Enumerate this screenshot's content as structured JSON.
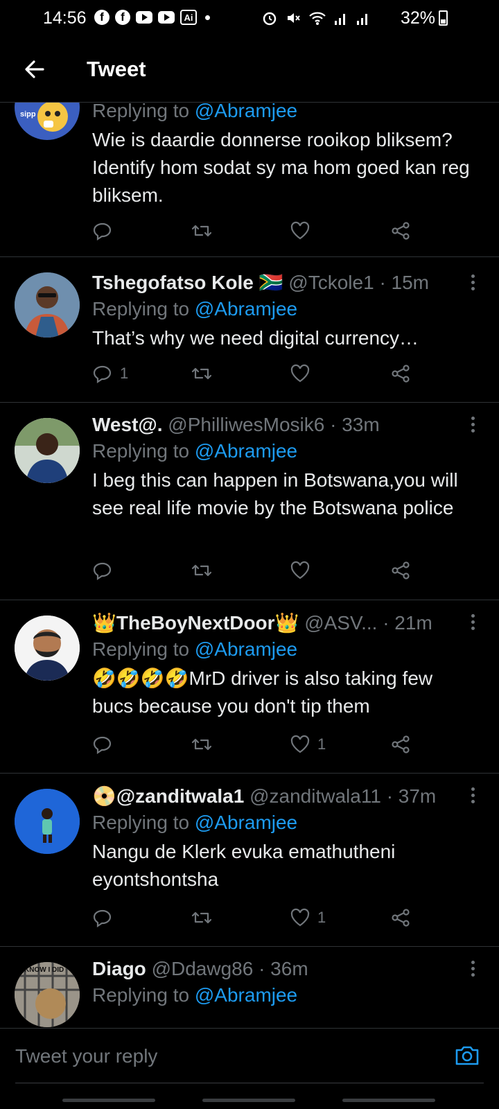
{
  "status_bar": {
    "time": "14:56",
    "battery": "32%",
    "app_icons": [
      "facebook-icon",
      "facebook-icon",
      "youtube-icon",
      "youtube-icon",
      "ai-icon",
      "dot"
    ],
    "system_icons": [
      "alarm-icon",
      "mute-icon",
      "wifi-icon",
      "signal-icon",
      "signal-icon"
    ]
  },
  "header": {
    "title": "Tweet",
    "back_icon": "arrow-left-icon"
  },
  "tweets": [
    {
      "name": "",
      "handle": "",
      "time": "",
      "replying_label": "Replying to",
      "mention": "@Abramjee",
      "text": "Wie is daardie donnerse rooikop bliksem? Identify hom sodat sy ma hom goed kan reg bliksem.",
      "replies": "",
      "likes": "",
      "avatar_text": "sipp"
    },
    {
      "name": "Tshegofatso Kole",
      "flag": "🇿🇦",
      "handle": "@Tckole1",
      "time": "· 15m",
      "replying_label": "Replying to",
      "mention": "@Abramjee",
      "text": "That’s why we need digital currency…",
      "replies": "1",
      "likes": ""
    },
    {
      "name": "West@.",
      "handle": "@PhilliwesMosik6",
      "time": "· 33m",
      "replying_label": "Replying to",
      "mention": "@Abramjee",
      "text": "I beg this can happen in Botswana,you will see real life movie by the Botswana police",
      "replies": "",
      "likes": ""
    },
    {
      "name": "👑TheBoyNextDoor👑",
      "handle": "@ASV...",
      "time": "· 21m",
      "replying_label": "Replying to",
      "mention": "@Abramjee",
      "text": "🤣🤣🤣🤣MrD driver is also taking few bucs because you don't tip them",
      "replies": "",
      "likes": "1"
    },
    {
      "name": "📀@zanditwala1",
      "handle": "@zanditwala11",
      "time": "· 37m",
      "replying_label": "Replying to",
      "mention": "@Abramjee",
      "text": "Nangu de Klerk evuka emathutheni eyontshontsha",
      "replies": "",
      "likes": "1"
    },
    {
      "name": "Diago",
      "handle": "@Ddawg86",
      "time": "· 36m",
      "replying_label": "Replying to",
      "mention": "@Abramjee",
      "text": "",
      "replies": "",
      "likes": "",
      "avatar_text": "KNOW I DID"
    }
  ],
  "composer": {
    "placeholder": "Tweet your reply",
    "camera_icon": "camera-icon"
  },
  "colors": {
    "accent": "#1d9bf0",
    "background": "#000000",
    "muted": "#71767b",
    "divider": "#2f3336"
  }
}
